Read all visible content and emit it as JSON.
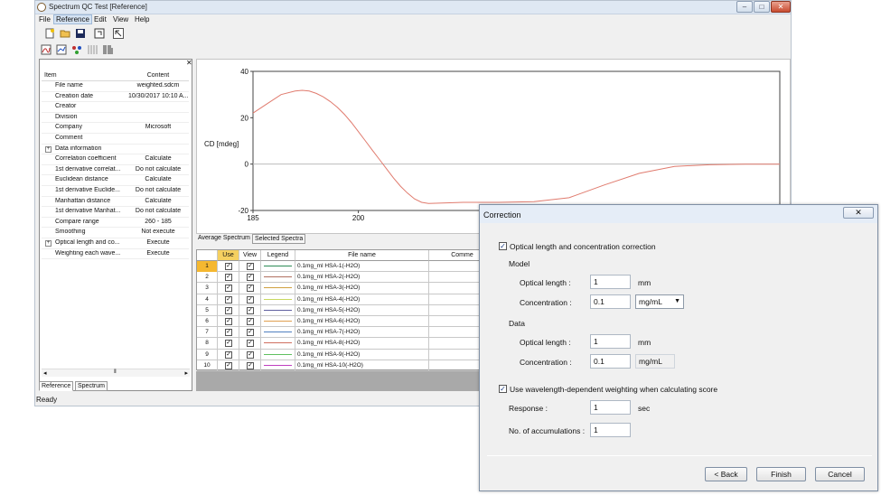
{
  "window": {
    "title": "Spectrum QC Test [Reference]",
    "minimize": "–",
    "maximize": "□",
    "close": "✕"
  },
  "menu": [
    "File",
    "Reference",
    "Edit",
    "View",
    "Help"
  ],
  "toolbar_icons": [
    "new-file-icon",
    "open-folder-icon",
    "save-icon",
    "refresh-icon",
    "cursor-icon",
    "spectrum-icon",
    "chart-icon",
    "molecule-icon",
    "grid-icon",
    "barcode-icon"
  ],
  "properties": {
    "col_item": "Item",
    "col_content": "Content",
    "rows": [
      {
        "k": "File name",
        "v": "weighted.sdcm",
        "exp": ""
      },
      {
        "k": "Creation date",
        "v": "10/30/2017 10:10 A...",
        "exp": ""
      },
      {
        "k": "Creator",
        "v": "",
        "exp": ""
      },
      {
        "k": "Division",
        "v": "",
        "exp": ""
      },
      {
        "k": "Company",
        "v": "Microsoft",
        "exp": ""
      },
      {
        "k": "Comment",
        "v": "",
        "exp": ""
      },
      {
        "k": "Data information",
        "v": "",
        "exp": "+"
      },
      {
        "k": "Correlation coefficient",
        "v": "Calculate",
        "exp": ""
      },
      {
        "k": "1st derivative correlat...",
        "v": "Do not calculate",
        "exp": ""
      },
      {
        "k": "Euclidean distance",
        "v": "Calculate",
        "exp": ""
      },
      {
        "k": "1st derivative Euclide...",
        "v": "Do not calculate",
        "exp": ""
      },
      {
        "k": "Manhattan distance",
        "v": "Calculate",
        "exp": ""
      },
      {
        "k": "1st derivative Manhat...",
        "v": "Do not calculate",
        "exp": ""
      },
      {
        "k": "Compare range",
        "v": "260 - 185",
        "exp": ""
      },
      {
        "k": "Smoothing",
        "v": "Not execute",
        "exp": ""
      },
      {
        "k": "Optical length and co...",
        "v": "Execute",
        "exp": "+"
      },
      {
        "k": "Weighting each wave...",
        "v": "Execute",
        "exp": ""
      }
    ]
  },
  "left_tabs": {
    "reference": "Reference",
    "spectrum": "Spectrum"
  },
  "chart_tabs": {
    "average": "Average Spectrum",
    "selected": "Selected Spectra"
  },
  "chart_data": {
    "type": "line",
    "ylabel": "CD [mdeg]",
    "xlim": [
      185,
      260
    ],
    "ylim": [
      -20,
      40
    ],
    "x_ticks": [
      "185",
      "200"
    ],
    "y_ticks": [
      "40",
      "20",
      "0",
      "-20"
    ],
    "color": "#e07b6e",
    "series": [
      {
        "x": [
          185,
          187,
          189,
          191,
          192,
          193,
          194,
          195,
          196,
          197,
          198,
          199,
          200,
          201,
          202,
          203,
          204,
          205,
          206,
          207,
          208,
          209,
          210,
          212,
          215,
          220,
          225,
          230,
          235,
          240,
          245,
          250,
          255,
          260
        ],
        "y": [
          22,
          26,
          30,
          31.5,
          31.8,
          31.5,
          30.5,
          29,
          27,
          24.5,
          21.5,
          18,
          14,
          10,
          6,
          2,
          -2,
          -6,
          -9.5,
          -12.5,
          -15,
          -16.5,
          -17,
          -16.8,
          -16.5,
          -16.5,
          -16.2,
          -14.5,
          -9,
          -4,
          -1,
          -0.3,
          0,
          0
        ]
      }
    ]
  },
  "grid": {
    "headers": {
      "num": "",
      "use": "Use",
      "view": "View",
      "legend": "Legend",
      "file": "File name",
      "comment": "Comme"
    },
    "rows": [
      {
        "num": "1",
        "file": "0.1mg_ml HSA-1(-H2O)",
        "color": "#2e8b57"
      },
      {
        "num": "2",
        "file": "0.1mg_ml HSA-2(-H2O)",
        "color": "#b07060"
      },
      {
        "num": "3",
        "file": "0.1mg_ml HSA-3(-H2O)",
        "color": "#d0a040"
      },
      {
        "num": "4",
        "file": "0.1mg_ml HSA-4(-H2O)",
        "color": "#c8d860"
      },
      {
        "num": "5",
        "file": "0.1mg_ml HSA-5(-H2O)",
        "color": "#6060a0"
      },
      {
        "num": "6",
        "file": "0.1mg_ml HSA-6(-H2O)",
        "color": "#e0a050"
      },
      {
        "num": "7",
        "file": "0.1mg_ml HSA-7(-H2O)",
        "color": "#5080c0"
      },
      {
        "num": "8",
        "file": "0.1mg_ml HSA-8(-H2O)",
        "color": "#d07060"
      },
      {
        "num": "9",
        "file": "0.1mg_ml HSA-9(-H2O)",
        "color": "#60c060"
      },
      {
        "num": "10",
        "file": "0.1mg_ml HSA-10(-H2O)",
        "color": "#c040c0"
      }
    ],
    "check": "✓"
  },
  "status": "Ready",
  "dialog": {
    "title": "Correction",
    "close": "✕",
    "opt_corr_label": "Optical length and concentration correction",
    "model_label": "Model",
    "model_len_label": "Optical length :",
    "model_len_value": "1",
    "model_len_unit": "mm",
    "model_conc_label": "Concentration :",
    "model_conc_value": "0.1",
    "model_conc_unit": "mg/mL",
    "data_label": "Data",
    "data_len_label": "Optical length :",
    "data_len_value": "1",
    "data_len_unit": "mm",
    "data_conc_label": "Concentration :",
    "data_conc_value": "0.1",
    "data_conc_unit": "mg/mL",
    "weight_label": "Use wavelength-dependent weighting when calculating score",
    "response_label": "Response :",
    "response_value": "1",
    "response_unit": "sec",
    "accum_label": "No. of accumulations :",
    "accum_value": "1",
    "back": "< Back",
    "finish": "Finish",
    "cancel": "Cancel"
  }
}
